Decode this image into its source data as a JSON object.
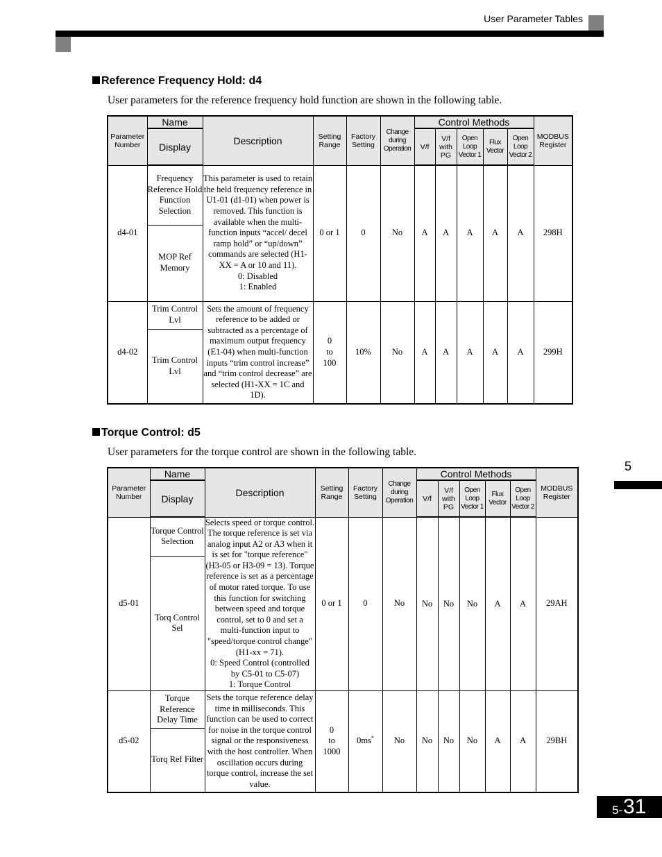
{
  "header": {
    "running_title": "User Parameter Tables"
  },
  "table_headers": {
    "param_number": "Parameter Number",
    "name": "Name",
    "display": "Display",
    "description": "Description",
    "setting_range": "Setting Range",
    "factory_setting": "Factory Setting",
    "change_during_operation": "Change during Operation",
    "control_methods": "Control Methods",
    "vf": "V/f",
    "vf_pg": "V/f with PG",
    "olv1": "Open Loop Vector 1",
    "flux_vector": "Flux Vector",
    "olv2": "Open Loop Vector 2",
    "modbus": "MODBUS Register"
  },
  "sections": [
    {
      "title": "Reference Frequency Hold: d4",
      "intro": "User parameters for the reference frequency hold function are shown in the following table.",
      "rows": [
        {
          "number": "d4-01",
          "name": "Frequency Reference Hold Function Selection",
          "display": "MOP Ref Memory",
          "description": [
            "This parameter is used to retain the held frequency reference in U1-01 (d1-01) when power is removed. This function is available when the multi-function inputs “accel/ decel ramp hold” or “up/down” commands are selected (H1-XX = A or 10 and 11).",
            "0: Disabled",
            "1:  Enabled"
          ],
          "setting_range": [
            "0 or 1"
          ],
          "factory_setting": "0",
          "factory_note": "",
          "change_during_operation": "No",
          "methods": [
            "A",
            "A",
            "A",
            "A",
            "A"
          ],
          "modbus": "298H"
        },
        {
          "number": "d4-02",
          "name": "Trim Control Lvl",
          "display": "Trim Control Lvl",
          "description": [
            "Sets the amount of frequency reference to be added or subtracted as a percentage of maximum output frequency (E1-04) when multi-function inputs “trim control increase” and “trim control decrease” are selected (H1-XX = 1C and 1D)."
          ],
          "setting_range": [
            "0",
            "to",
            "100"
          ],
          "factory_setting": "10%",
          "factory_note": "",
          "change_during_operation": "No",
          "methods": [
            "A",
            "A",
            "A",
            "A",
            "A"
          ],
          "modbus": "299H"
        }
      ]
    },
    {
      "title": "Torque Control: d5",
      "intro": "User parameters for the torque control are shown in the following table.",
      "rows": [
        {
          "number": "d5-01",
          "name": "Torque Control Selection",
          "display": "Torq Control Sel",
          "description": [
            "Selects speed or torque control. The torque reference is set via analog input A2 or A3 when it is set for \"torque reference\" (H3-05 or H3-09 = 13). Torque reference is set as a percentage of motor rated torque. To use this function for switching between speed and torque control, set to 0 and set a multi-function input to \"speed/torque control change\" (H1-xx = 71).",
            "0:  Speed Control (controlled",
            "by C5-01 to C5-07)",
            "1:  Torque Control"
          ],
          "setting_range": [
            "0 or 1"
          ],
          "factory_setting": "0",
          "factory_note": "",
          "change_during_operation": "No",
          "methods": [
            "No",
            "No",
            "No",
            "A",
            "A"
          ],
          "modbus": "29AH"
        },
        {
          "number": "d5-02",
          "name": "Torque Reference Delay Time",
          "display": "Torq Ref Filter",
          "description": [
            "Sets the torque reference delay time in milliseconds. This function can be used to correct for noise in the torque control signal or the responsiveness with the host controller. When oscillation occurs during torque control, increase the set value."
          ],
          "setting_range": [
            "0",
            "to",
            "1000"
          ],
          "factory_setting": "0ms",
          "factory_note": "*",
          "change_during_operation": "No",
          "methods": [
            "No",
            "No",
            "No",
            "A",
            "A"
          ],
          "modbus": "29BH"
        }
      ]
    }
  ],
  "side_tab": {
    "chapter": "5"
  },
  "footer": {
    "page_prefix": "5-",
    "page_number": "31"
  }
}
